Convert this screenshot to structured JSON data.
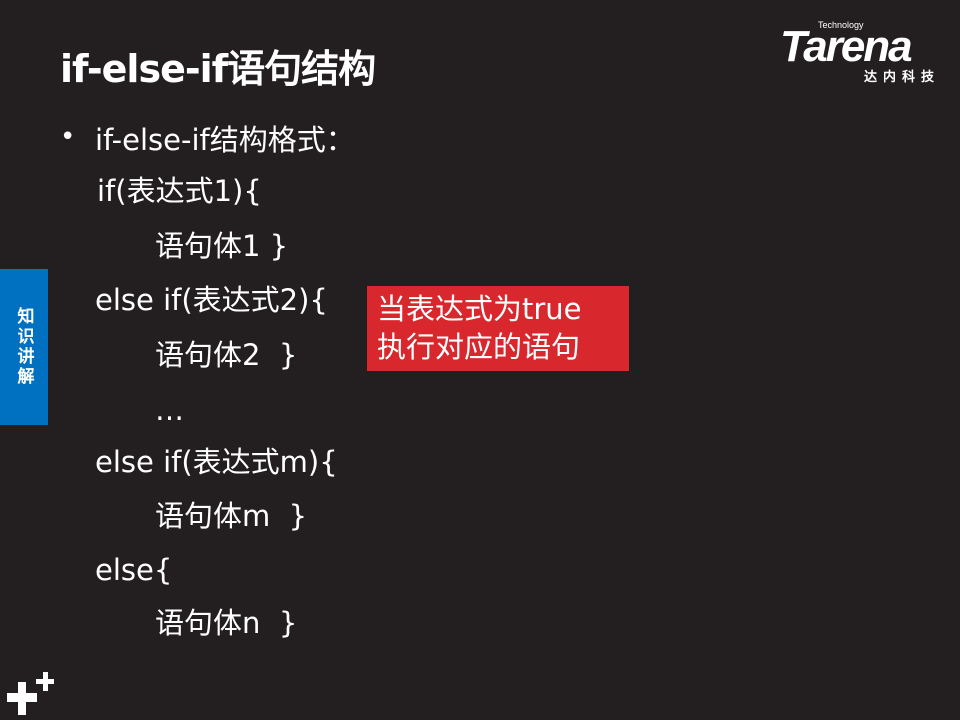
{
  "title": "if-else-if语句结构",
  "logo": {
    "technology": "Technology",
    "brand": "Tarena",
    "subtitle": "达内科技"
  },
  "side_tab": "知识讲解",
  "bullet": "•",
  "lines": [
    "if-else-if结构格式：",
    "if(表达式1){",
    "语句体1 }",
    "else if(表达式2){",
    "语句体2  }",
    "…",
    "else if(表达式m){",
    "语句体m  }",
    "else{",
    "语句体n  }"
  ],
  "note": [
    "当表达式为true",
    "执行对应的语句"
  ],
  "colors": {
    "background": "#231f20",
    "side_tab": "#0070c0",
    "note": "#d9272e"
  }
}
